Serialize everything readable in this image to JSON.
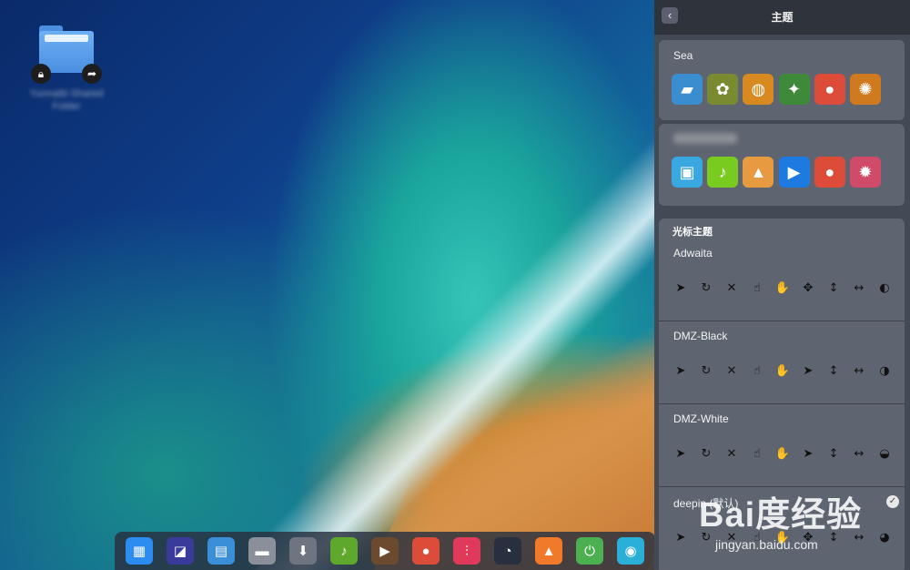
{
  "desktop": {
    "folder_label": "Yunnaibi Shared Folder"
  },
  "dock": {
    "apps": [
      {
        "name": "launcher",
        "glyph": "▦",
        "color": "#2d8cf0"
      },
      {
        "name": "screenshot",
        "glyph": "◪",
        "color": "#3a3a9a"
      },
      {
        "name": "multitasking",
        "glyph": "▤",
        "color": "#3b8ed8"
      },
      {
        "name": "file-manager",
        "glyph": "▬",
        "color": "#8a8f99"
      },
      {
        "name": "app-store",
        "glyph": "⬇",
        "color": "#6e7480"
      },
      {
        "name": "music",
        "glyph": "♪",
        "color": "#5ea82c"
      },
      {
        "name": "video",
        "glyph": "▶",
        "color": "#6b4a30"
      },
      {
        "name": "chrome",
        "glyph": "●",
        "color": "#dd4b39"
      },
      {
        "name": "system-monitor",
        "glyph": "⫶",
        "color": "#e03a5a"
      },
      {
        "name": "control-center",
        "glyph": "◔",
        "color": "#283040"
      },
      {
        "name": "trash",
        "glyph": "▲",
        "color": "#f07a2a"
      },
      {
        "name": "power",
        "glyph": "⏻",
        "color": "#4caf50"
      },
      {
        "name": "browser",
        "glyph": "◉",
        "color": "#2ab0d8"
      }
    ]
  },
  "panel": {
    "title": "主题",
    "icon_themes": [
      {
        "name": "Sea",
        "icons": [
          {
            "glyph": "▰",
            "color": "#3a8ed0"
          },
          {
            "glyph": "✿",
            "color": "#7a8a30"
          },
          {
            "glyph": "◍",
            "color": "#d88a20"
          },
          {
            "glyph": "✦",
            "color": "#3f8a3a"
          },
          {
            "glyph": "●",
            "color": "#dd4b39"
          },
          {
            "glyph": "✺",
            "color": "#d07a20"
          }
        ]
      },
      {
        "name": "",
        "icons": [
          {
            "glyph": "▣",
            "color": "#3aa8e0"
          },
          {
            "glyph": "♪",
            "color": "#7acb20"
          },
          {
            "glyph": "▲",
            "color": "#e89a40"
          },
          {
            "glyph": "▶",
            "color": "#1e7ae0"
          },
          {
            "glyph": "●",
            "color": "#dd4b39"
          },
          {
            "glyph": "✹",
            "color": "#d04a6a"
          }
        ]
      }
    ],
    "cursor_section_title": "光标主题",
    "cursor_themes": [
      {
        "name": "Adwaita",
        "cursors": [
          "➤",
          "↻",
          "✕",
          "☝",
          "✋",
          "✥",
          "↕",
          "↔",
          "◐"
        ]
      },
      {
        "name": "DMZ-Black",
        "cursors": [
          "➤",
          "↻",
          "✕",
          "☝",
          "✋",
          "➤",
          "↕",
          "↔",
          "◑"
        ]
      },
      {
        "name": "DMZ-White",
        "cursors": [
          "➤",
          "↻",
          "✕",
          "☝",
          "✋",
          "➤",
          "↕",
          "↔",
          "◒"
        ]
      },
      {
        "name": "deepin (默认)",
        "cursors": [
          "➤",
          "↻",
          "✕",
          "☝",
          "✋",
          "✥",
          "↕",
          "↔",
          "◕"
        ],
        "selected": true
      }
    ]
  },
  "watermark": {
    "brand": "Bai度经验",
    "url": "jingyan.baidu.com"
  }
}
